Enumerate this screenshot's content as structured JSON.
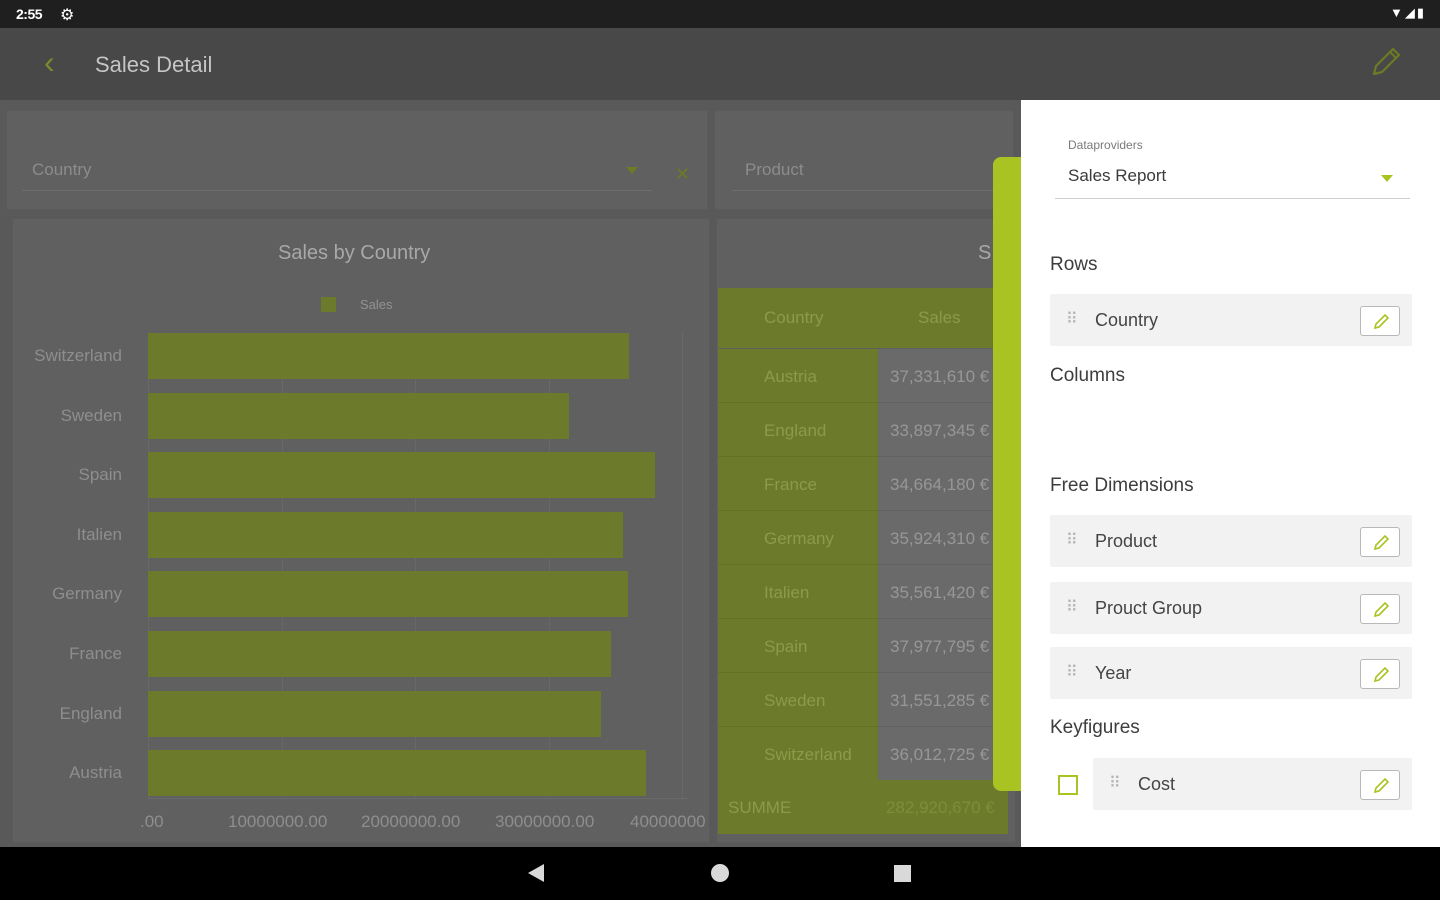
{
  "status_bar": {
    "time": "2:55",
    "settings_icon": "gear-icon",
    "system_icons": "wifi-icon signal-icon battery-icon"
  },
  "app_bar": {
    "title": "Sales Detail",
    "back_icon": "chevron-left-icon",
    "edit_icon": "pencil-icon"
  },
  "filters": {
    "country": {
      "placeholder": "Country"
    },
    "product": {
      "placeholder": "Product"
    }
  },
  "chart_data": {
    "type": "bar",
    "orientation": "horizontal",
    "title": "Sales by Country",
    "categories": [
      "Switzerland",
      "Sweden",
      "Spain",
      "Italien",
      "Germany",
      "France",
      "England",
      "Austria"
    ],
    "series": [
      {
        "name": "Sales",
        "values": [
          36012725,
          31551285,
          37977795,
          35561420,
          35924310,
          34664180,
          33897345,
          37331610
        ]
      }
    ],
    "x_ticks": [
      ".00",
      "10000000.00",
      "20000000.00",
      "30000000.00",
      "40000000"
    ],
    "xlim": [
      0,
      40000000
    ],
    "grid": true,
    "legend": "top"
  },
  "table": {
    "title_partial": "S",
    "headers": [
      "Country",
      "Sales"
    ],
    "rows": [
      {
        "country": "Austria",
        "sales": "37,331,610 €"
      },
      {
        "country": "England",
        "sales": "33,897,345 €"
      },
      {
        "country": "France",
        "sales": "34,664,180 €"
      },
      {
        "country": "Germany",
        "sales": "35,924,310 €"
      },
      {
        "country": "Italien",
        "sales": "35,561,420 €"
      },
      {
        "country": "Spain",
        "sales": "37,977,795 €"
      },
      {
        "country": "Sweden",
        "sales": "31,551,285 €"
      },
      {
        "country": "Switzerland",
        "sales": "36,012,725 €"
      }
    ],
    "sum_label": "SUMME",
    "sum_value": "282,920,670 €"
  },
  "panel": {
    "dataproviders_caption": "Dataproviders",
    "dataprovider_value": "Sales Report",
    "rows_title": "Rows",
    "rows_items": [
      "Country"
    ],
    "columns_title": "Columns",
    "free_dimensions_title": "Free Dimensions",
    "free_dimensions": [
      "Product",
      "Prouct Group",
      "Year"
    ],
    "keyfigures_title": "Keyfigures",
    "keyfigures": [
      "Cost"
    ]
  },
  "colors": {
    "accent": "#a8c322",
    "bar": "#6c7a2b",
    "overlay_bg": "#595959"
  }
}
